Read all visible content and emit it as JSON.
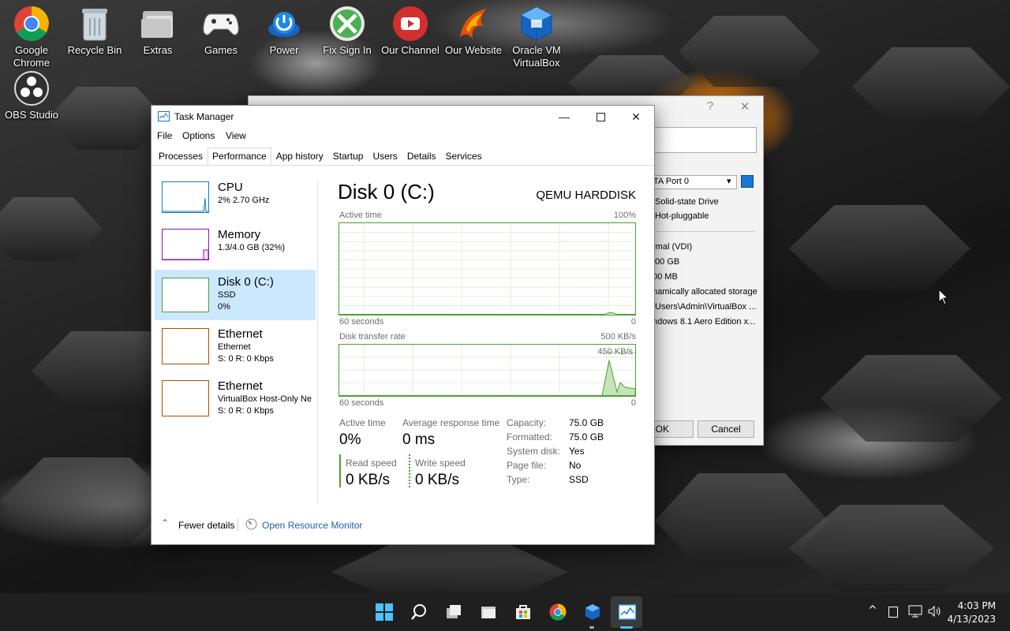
{
  "desktop": {
    "icons": [
      {
        "label1": "Google",
        "label2": "Chrome",
        "icon": "chrome-icon"
      },
      {
        "label1": "Recycle Bin",
        "label2": "",
        "icon": "recycle-bin-icon"
      },
      {
        "label1": "Extras",
        "label2": "",
        "icon": "folder-icon"
      },
      {
        "label1": "Games",
        "label2": "",
        "icon": "gamepad-icon"
      },
      {
        "label1": "Power",
        "label2": "",
        "icon": "power-icon"
      },
      {
        "label1": "Fix Sign In",
        "label2": "",
        "icon": "xbox-icon"
      },
      {
        "label1": "Our Channel",
        "label2": "",
        "icon": "youtube-icon"
      },
      {
        "label1": "Our Website",
        "label2": "",
        "icon": "phoenix-icon"
      },
      {
        "label1": "Oracle VM",
        "label2": "VirtualBox",
        "icon": "virtualbox-icon"
      },
      {
        "label1": "OBS Studio",
        "label2": "",
        "icon": "obs-icon"
      }
    ]
  },
  "bg_dialog": {
    "port_value": "TA Port 0",
    "checkbox1": "Solid-state Drive",
    "checkbox2": "Hot-pluggable",
    "info": [
      "rmal (VDI)",
      ".00 GB",
      "00 MB",
      "namically allocated storage",
      "\\Users\\Admin\\VirtualBox ...",
      "ndows 8.1 Aero Edition x..."
    ],
    "ok_label": "OK",
    "cancel_label": "Cancel",
    "help_glyph": "?"
  },
  "task_manager": {
    "title": "Task Manager",
    "menu": [
      "File",
      "Options",
      "View"
    ],
    "tabs": [
      "Processes",
      "Performance",
      "App history",
      "Startup",
      "Users",
      "Details",
      "Services"
    ],
    "active_tab": "Performance",
    "sidebar": [
      {
        "name": "CPU",
        "line1": "2% 2.70 GHz",
        "line2": "",
        "color": "#117dbb"
      },
      {
        "name": "Memory",
        "line1": "1.3/4.0 GB (32%)",
        "line2": "",
        "color": "#8b12ae"
      },
      {
        "name": "Disk 0 (C:)",
        "line1": "SSD",
        "line2": "0%",
        "color": "#4da033"
      },
      {
        "name": "Ethernet",
        "line1": "Ethernet",
        "line2": "S: 0 R: 0 Kbps",
        "color": "#a74f01"
      },
      {
        "name": "Ethernet",
        "line1": "VirtualBox Host-Only Ne",
        "line2": "S: 0 R: 0 Kbps",
        "color": "#a74f01"
      }
    ],
    "disk": {
      "title": "Disk 0 (C:)",
      "model": "QEMU HARDDISK",
      "graph1_label": "Active time",
      "graph1_max": "100%",
      "graph1_time": "60 seconds",
      "graph1_min": "0",
      "graph2_label": "Disk transfer rate",
      "graph2_max": "500 KB/s",
      "graph2_peak": "450 KB/s",
      "graph2_time": "60 seconds",
      "graph2_min": "0",
      "active_time_label": "Active time",
      "active_time_value": "0%",
      "avg_resp_label": "Average response time",
      "avg_resp_value": "0 ms",
      "read_label": "Read speed",
      "read_value": "0 KB/s",
      "write_label": "Write speed",
      "write_value": "0 KB/s",
      "props": [
        {
          "k": "Capacity:",
          "v": "75.0 GB"
        },
        {
          "k": "Formatted:",
          "v": "75.0 GB"
        },
        {
          "k": "System disk:",
          "v": "Yes"
        },
        {
          "k": "Page file:",
          "v": "No"
        },
        {
          "k": "Type:",
          "v": "SSD"
        }
      ],
      "accent": "#4da033"
    },
    "footer": {
      "fewer_details": "Fewer details",
      "resource_monitor": "Open Resource Monitor"
    }
  },
  "taskbar": {
    "time": "4:03 PM",
    "date": "4/13/2023"
  }
}
